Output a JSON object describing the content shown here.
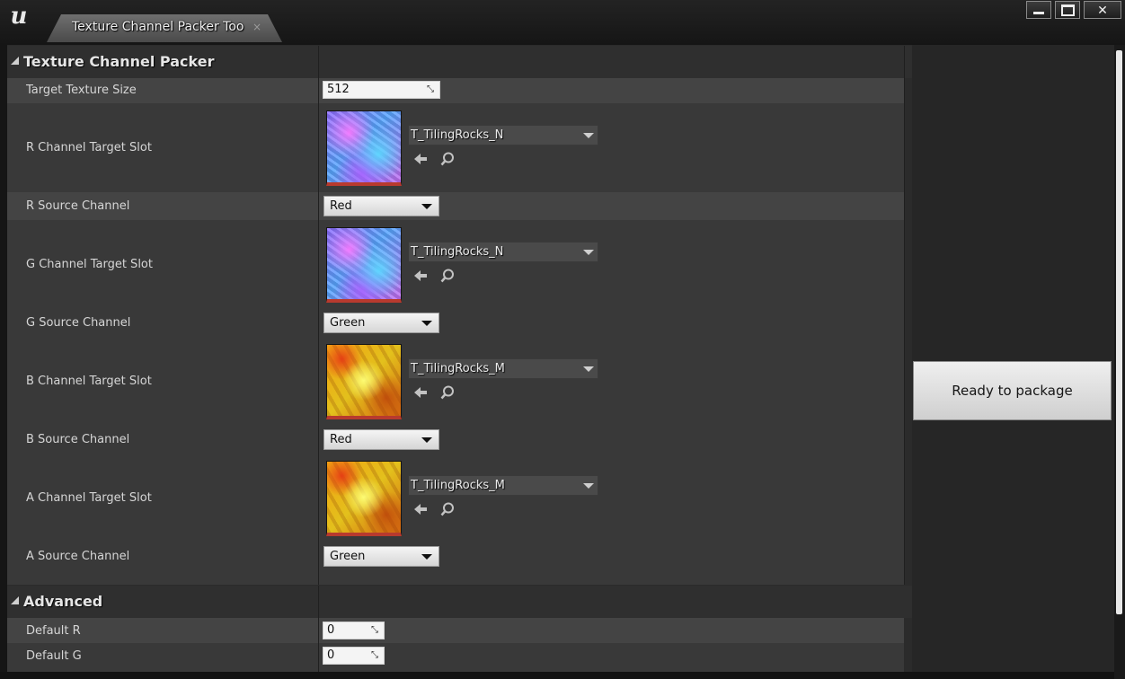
{
  "window": {
    "tab_title": "Texture Channel Packer Too",
    "tab_close_glyph": "×",
    "controls": {
      "minimize": "minimize-icon",
      "maximize": "maximize-icon",
      "close": "✕"
    }
  },
  "sections": {
    "main": {
      "title": "Texture Channel Packer"
    },
    "advanced": {
      "title": "Advanced"
    }
  },
  "rows": {
    "target_size": {
      "label": "Target Texture Size",
      "value": "512"
    },
    "r_slot": {
      "label": "R Channel Target Slot",
      "asset": "T_TilingRocks_N"
    },
    "r_source": {
      "label": "R Source Channel",
      "value": "Red"
    },
    "g_slot": {
      "label": "G Channel Target Slot",
      "asset": "T_TilingRocks_N"
    },
    "g_source": {
      "label": "G Source Channel",
      "value": "Green"
    },
    "b_slot": {
      "label": "B Channel Target Slot",
      "asset": "T_TilingRocks_M"
    },
    "b_source": {
      "label": "B Source Channel",
      "value": "Red"
    },
    "a_slot": {
      "label": "A Channel Target Slot",
      "asset": "T_TilingRocks_M"
    },
    "a_source": {
      "label": "A Source Channel",
      "value": "Green"
    },
    "default_r": {
      "label": "Default R",
      "value": "0"
    },
    "default_g": {
      "label": "Default G",
      "value": "0"
    }
  },
  "status_button": {
    "label": "Ready to package"
  },
  "colors": {
    "panel_bg": "#2b2b2b",
    "row_bg": "#393939",
    "row_alt_bg": "#444444",
    "thumbnail_border": "#b83a2e"
  }
}
